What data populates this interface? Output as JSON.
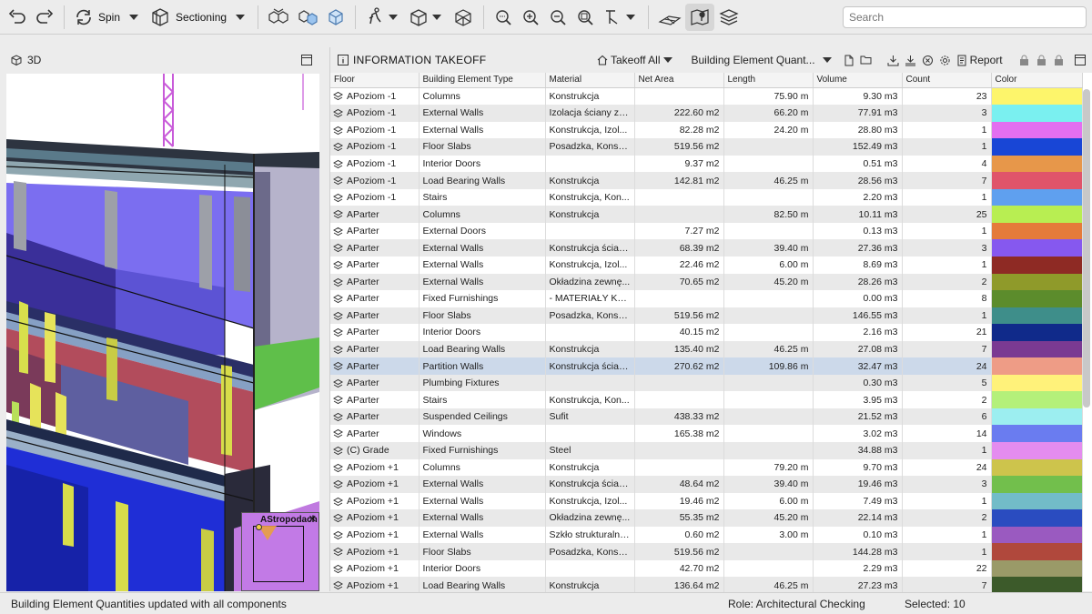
{
  "toolbar": {
    "spin_label": "Spin",
    "sectioning_label": "Sectioning",
    "search_placeholder": "Search",
    "icons": [
      "undo-icon",
      "redo-icon",
      "spin-icon",
      "sectioning-icon",
      "boxes-icon",
      "explode-icon",
      "cube-select-icon",
      "walk-icon",
      "cube-icon",
      "cube-wire-icon",
      "zoom-fit-icon",
      "zoom-in-icon",
      "zoom-out-icon",
      "zoom-window-icon",
      "pick-icon",
      "floorplan-icon",
      "map-pin-icon",
      "layers-icon"
    ]
  },
  "viewport": {
    "title": "3D",
    "minimap_label": "AStropodach"
  },
  "takeoff": {
    "title": "INFORMATION TAKEOFF",
    "scope_label": "Takeoff All",
    "template_label": "Building Element Quant...",
    "report_label": "Report",
    "columns": [
      "Floor",
      "Building Element Type",
      "Material",
      "Net Area",
      "Length",
      "Volume",
      "Count",
      "Color"
    ],
    "rows": [
      {
        "floor": "APoziom -1",
        "type": "Columns",
        "material": "Konstrukcja",
        "area": "",
        "length": "75.90 m",
        "volume": "9.30 m3",
        "count": "23",
        "color": "#fdf56b"
      },
      {
        "floor": "APoziom -1",
        "type": "External Walls",
        "material": "Izolacja ściany ze...",
        "area": "222.60 m2",
        "length": "66.20 m",
        "volume": "77.91 m3",
        "count": "3",
        "color": "#7af0f0"
      },
      {
        "floor": "APoziom -1",
        "type": "External Walls",
        "material": "Konstrukcja, Izol...",
        "area": "82.28 m2",
        "length": "24.20 m",
        "volume": "28.80 m3",
        "count": "1",
        "color": "#e36ff0"
      },
      {
        "floor": "APoziom -1",
        "type": "Floor Slabs",
        "material": "Posadzka, Konstr...",
        "area": "519.56 m2",
        "length": "",
        "volume": "152.49 m3",
        "count": "1",
        "color": "#1846d6"
      },
      {
        "floor": "APoziom -1",
        "type": "Interior Doors",
        "material": "",
        "area": "9.37 m2",
        "length": "",
        "volume": "0.51 m3",
        "count": "4",
        "color": "#e7974a"
      },
      {
        "floor": "APoziom -1",
        "type": "Load Bearing Walls",
        "material": "Konstrukcja",
        "area": "142.81 m2",
        "length": "46.25 m",
        "volume": "28.56 m3",
        "count": "7",
        "color": "#e0546a"
      },
      {
        "floor": "APoziom -1",
        "type": "Stairs",
        "material": "Konstrukcja, Kon...",
        "area": "",
        "length": "",
        "volume": "2.20 m3",
        "count": "1",
        "color": "#5fa0ef"
      },
      {
        "floor": "AParter",
        "type": "Columns",
        "material": "Konstrukcja",
        "area": "",
        "length": "82.50 m",
        "volume": "10.11 m3",
        "count": "25",
        "color": "#b8ee52"
      },
      {
        "floor": "AParter",
        "type": "External Doors",
        "material": "",
        "area": "7.27 m2",
        "length": "",
        "volume": "0.13 m3",
        "count": "1",
        "color": "#e57b3a"
      },
      {
        "floor": "AParter",
        "type": "External Walls",
        "material": "Konstrukcja ścian...",
        "area": "68.39 m2",
        "length": "39.40 m",
        "volume": "27.36 m3",
        "count": "3",
        "color": "#8658ef"
      },
      {
        "floor": "AParter",
        "type": "External Walls",
        "material": "Konstrukcja, Izol...",
        "area": "22.46 m2",
        "length": "6.00 m",
        "volume": "8.69 m3",
        "count": "1",
        "color": "#8e2a24"
      },
      {
        "floor": "AParter",
        "type": "External Walls",
        "material": "Okładzina zewnę...",
        "area": "70.65 m2",
        "length": "45.20 m",
        "volume": "28.26 m3",
        "count": "2",
        "color": "#8f9a2a"
      },
      {
        "floor": "AParter",
        "type": "Fixed Furnishings",
        "material": "- MATERIAŁY KO...",
        "area": "",
        "length": "",
        "volume": "0.00 m3",
        "count": "8",
        "color": "#5c8c2c"
      },
      {
        "floor": "AParter",
        "type": "Floor Slabs",
        "material": "Posadzka, Konstr...",
        "area": "519.56 m2",
        "length": "",
        "volume": "146.55 m3",
        "count": "1",
        "color": "#3e8e8a"
      },
      {
        "floor": "AParter",
        "type": "Interior Doors",
        "material": "",
        "area": "40.15 m2",
        "length": "",
        "volume": "2.16 m3",
        "count": "21",
        "color": "#102a8a"
      },
      {
        "floor": "AParter",
        "type": "Load Bearing Walls",
        "material": "Konstrukcja",
        "area": "135.40 m2",
        "length": "46.25 m",
        "volume": "27.08 m3",
        "count": "7",
        "color": "#7a3a92"
      },
      {
        "floor": "AParter",
        "type": "Partition Walls",
        "material": "Konstrukcja ścian...",
        "area": "270.62 m2",
        "length": "109.86 m",
        "volume": "32.47 m3",
        "count": "24",
        "color": "#ee9c86",
        "selected": true
      },
      {
        "floor": "AParter",
        "type": "Plumbing Fixtures",
        "material": "",
        "area": "",
        "length": "",
        "volume": "0.30 m3",
        "count": "5",
        "color": "#fff27a"
      },
      {
        "floor": "AParter",
        "type": "Stairs",
        "material": "Konstrukcja, Kon...",
        "area": "",
        "length": "",
        "volume": "3.95 m3",
        "count": "2",
        "color": "#b4f07a"
      },
      {
        "floor": "AParter",
        "type": "Suspended Ceilings",
        "material": "Sufit",
        "area": "438.33 m2",
        "length": "",
        "volume": "21.52 m3",
        "count": "6",
        "color": "#9ceef0"
      },
      {
        "floor": "AParter",
        "type": "Windows",
        "material": "",
        "area": "165.38 m2",
        "length": "",
        "volume": "3.02 m3",
        "count": "14",
        "color": "#6a7cf0"
      },
      {
        "floor": "(C) Grade",
        "type": "Fixed Furnishings",
        "material": "Steel",
        "area": "",
        "length": "",
        "volume": "34.88 m3",
        "count": "1",
        "color": "#e48cef"
      },
      {
        "floor": "APoziom +1",
        "type": "Columns",
        "material": "Konstrukcja",
        "area": "",
        "length": "79.20 m",
        "volume": "9.70 m3",
        "count": "24",
        "color": "#cdc44c"
      },
      {
        "floor": "APoziom +1",
        "type": "External Walls",
        "material": "Konstrukcja ścian...",
        "area": "48.64 m2",
        "length": "39.40 m",
        "volume": "19.46 m3",
        "count": "3",
        "color": "#72bf4c"
      },
      {
        "floor": "APoziom +1",
        "type": "External Walls",
        "material": "Konstrukcja, Izol...",
        "area": "19.46 m2",
        "length": "6.00 m",
        "volume": "7.49 m3",
        "count": "1",
        "color": "#72bcc8"
      },
      {
        "floor": "APoziom +1",
        "type": "External Walls",
        "material": "Okładzina zewnę...",
        "area": "55.35 m2",
        "length": "45.20 m",
        "volume": "22.14 m3",
        "count": "2",
        "color": "#2a4cc0"
      },
      {
        "floor": "APoziom +1",
        "type": "External Walls",
        "material": "Szkło strukturalne...",
        "area": "0.60 m2",
        "length": "3.00 m",
        "volume": "0.10 m3",
        "count": "1",
        "color": "#9a5ac0"
      },
      {
        "floor": "APoziom +1",
        "type": "Floor Slabs",
        "material": "Posadzka, Konstr...",
        "area": "519.56 m2",
        "length": "",
        "volume": "144.28 m3",
        "count": "1",
        "color": "#b0483c"
      },
      {
        "floor": "APoziom +1",
        "type": "Interior Doors",
        "material": "",
        "area": "42.70 m2",
        "length": "",
        "volume": "2.29 m3",
        "count": "22",
        "color": "#9a9a68"
      },
      {
        "floor": "APoziom +1",
        "type": "Load Bearing Walls",
        "material": "Konstrukcja",
        "area": "136.64 m2",
        "length": "46.25 m",
        "volume": "27.23 m3",
        "count": "7",
        "color": "#3c5a2a"
      }
    ]
  },
  "status": {
    "message": "Building Element Quantities updated with all components",
    "role": "Role: Architectural Checking",
    "selected": "Selected: 10"
  }
}
